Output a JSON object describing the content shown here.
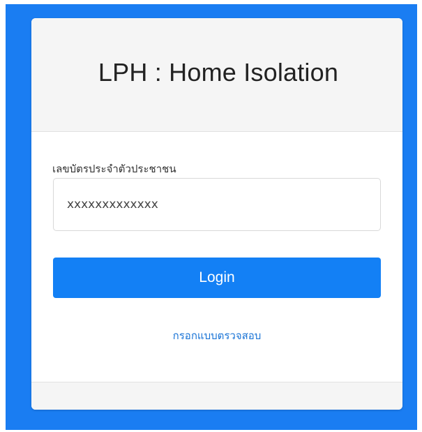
{
  "page": {
    "background_color": "#1a7df2",
    "accent_color": "#1380f5",
    "link_color": "#1a74d6"
  },
  "header": {
    "title": "LPH : Home Isolation"
  },
  "form": {
    "id_label": "เลขบัตรประจำตัวประชาชน",
    "id_value": "xxxxxxxxxxxxx",
    "login_label": "Login",
    "link_text": "กรอกแบบตรวจสอบ"
  }
}
